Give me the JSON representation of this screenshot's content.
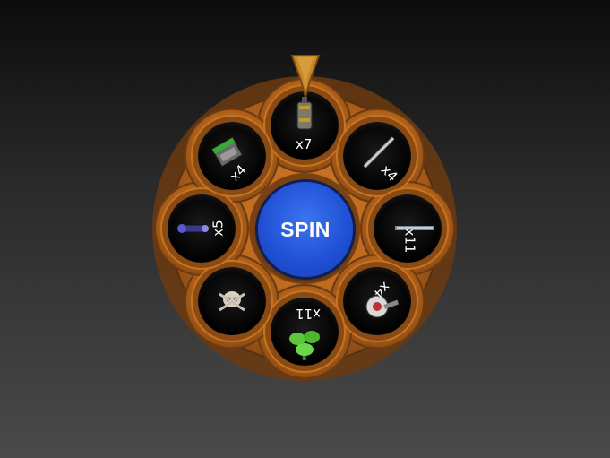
{
  "spin_button": {
    "label": "SPIN"
  },
  "slots": [
    {
      "name": "grenade",
      "icon": "grenade-icon",
      "count": "x7"
    },
    {
      "name": "sword",
      "icon": "sword-icon",
      "count": "x4"
    },
    {
      "name": "rifle",
      "icon": "rifle-icon",
      "count": "x11"
    },
    {
      "name": "turret",
      "icon": "turret-icon",
      "count": "x4"
    },
    {
      "name": "plant",
      "icon": "green-plant-icon",
      "count": "x11"
    },
    {
      "name": "skull",
      "icon": "skull-icon",
      "count": ""
    },
    {
      "name": "scope",
      "icon": "scope-icon",
      "count": "x5"
    },
    {
      "name": "ammo-box",
      "icon": "ammo-box-icon",
      "count": "x4"
    }
  ],
  "colors": {
    "wheel_body": "#b8651c",
    "wheel_rim": "#8a4a14",
    "spin": "#2a5ae0",
    "pointer": "#c8882a"
  }
}
